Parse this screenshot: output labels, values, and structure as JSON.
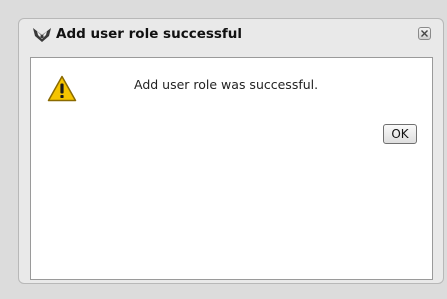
{
  "dialog": {
    "title": "Add user role successful",
    "app_icon": "app-logo-icon",
    "close_icon": "close-icon",
    "warning_icon": "warning-icon",
    "message": "Add user role was successful.",
    "ok_label": "OK"
  },
  "colors": {
    "warning_fill": "#f5c400",
    "warning_stroke": "#8a6a00",
    "content_bg": "#ffffff",
    "chrome_bg": "#e9e9e9"
  }
}
